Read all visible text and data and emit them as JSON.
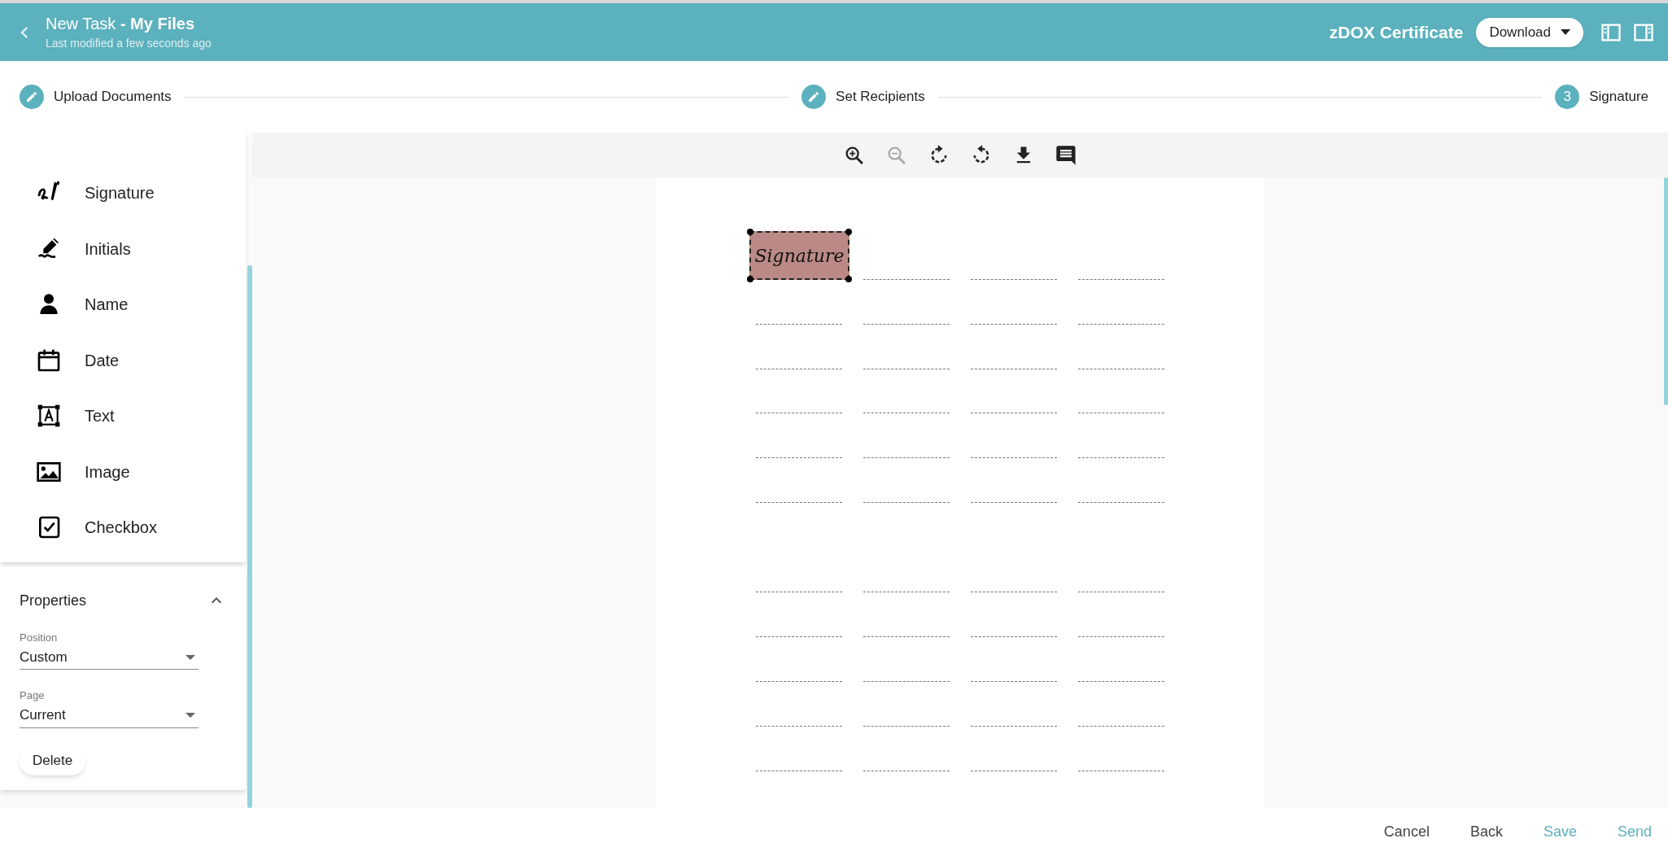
{
  "header": {
    "title": "New Task **- My Files**",
    "subtitle": "Last modified a few seconds ago",
    "certificate": "zDOX Certificate",
    "download": "Download"
  },
  "steps": [
    {
      "label": "Upload Documents",
      "kind": "edited"
    },
    {
      "label": "Set Recipients",
      "kind": "edited"
    },
    {
      "label": "Signature",
      "kind": "current",
      "number": "3"
    }
  ],
  "toolbar": [
    {
      "kind": "zoom-in",
      "disabled": false
    },
    {
      "kind": "zoom-out",
      "disabled": true
    },
    {
      "kind": "rotate-right",
      "disabled": false
    },
    {
      "kind": "rotate-left",
      "disabled": false
    },
    {
      "kind": "download",
      "disabled": false
    },
    {
      "kind": "comment",
      "disabled": false
    }
  ],
  "field_types": [
    {
      "label": "Signature",
      "kind": "signature"
    },
    {
      "label": "Initials",
      "kind": "initials"
    },
    {
      "label": "Name",
      "kind": "name"
    },
    {
      "label": "Date",
      "kind": "date"
    },
    {
      "label": "Text",
      "kind": "text"
    },
    {
      "label": "Image",
      "kind": "image"
    },
    {
      "label": "Checkbox",
      "kind": "checkbox"
    }
  ],
  "properties": {
    "title": "Properties",
    "expanded": true,
    "fields": [
      {
        "label": "Position",
        "value": "Custom"
      },
      {
        "label": "Page",
        "value": "Current"
      }
    ],
    "delete": "Delete"
  },
  "document": {
    "signature_field": {
      "text": "Signature",
      "selected": true
    }
  },
  "footer": [
    {
      "label": "Cancel",
      "primary": false
    },
    {
      "label": "Back",
      "primary": false
    },
    {
      "label": "Save",
      "primary": true
    },
    {
      "label": "Send",
      "primary": true
    }
  ]
}
